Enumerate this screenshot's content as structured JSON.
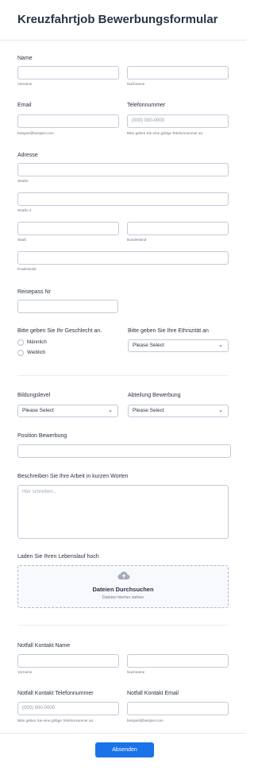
{
  "form": {
    "title": "Kreuzfahrtjob Bewerbungsformular"
  },
  "name": {
    "label": "Name",
    "first_sub": "Vorname",
    "last_sub": "Nachname"
  },
  "email": {
    "label": "Email",
    "sub": "beispiel@beispiel.com"
  },
  "phone": {
    "label": "Telefonnummer",
    "placeholder": "(000) 000-0000",
    "sub": "Bitte geben Sie eine gültige Telefonnummer an."
  },
  "address": {
    "label": "Adresse",
    "street_sub": "Straße",
    "street2_sub": "Straße 2",
    "city_sub": "Stadt",
    "state_sub": "Bundesland",
    "zip_sub": "Postleitzahl"
  },
  "passport": {
    "label": "Reisepass Nr"
  },
  "gender": {
    "label": "Bitte geben Sie Ihr Geschlecht an.",
    "options": [
      "Männlich",
      "Weiblich"
    ]
  },
  "ethnicity": {
    "label": "Bitte geben Sie Ihre Ethnizität an",
    "value": "Please Select"
  },
  "education": {
    "label": "Bildungslevel",
    "value": "Please Select"
  },
  "department": {
    "label": "Abteilung Bewerbung",
    "value": "Please Select"
  },
  "position": {
    "label": "Position Bewerbung"
  },
  "description": {
    "label": "Beschreiben Sie Ihre Arbeit in kurzen Worten",
    "placeholder": "Hier schreiben..."
  },
  "upload": {
    "label": "Laden Sie Ihren Lebenslauf hoch",
    "browse": "Dateien Durchsuchen",
    "drag": "Dateien hierher ziehen",
    "icon": "cloud-upload-icon"
  },
  "emergency_name": {
    "label": "Notfall Kontakt Name",
    "first_sub": "Vorname",
    "last_sub": "Nachname"
  },
  "emergency_phone": {
    "label": "Notfall Kontakt Telefonnummer",
    "placeholder": "(000) 000-0000",
    "sub": "Bitte geben Sie eine gültige Telefonnummer an."
  },
  "emergency_email": {
    "label": "Notfall Kontakt Email",
    "sub": "beispiel@beispiel.com"
  },
  "submit": {
    "label": "Absenden"
  },
  "colors": {
    "accent": "#1a73e8",
    "text": "#2c3345",
    "border": "#c3cad8"
  }
}
